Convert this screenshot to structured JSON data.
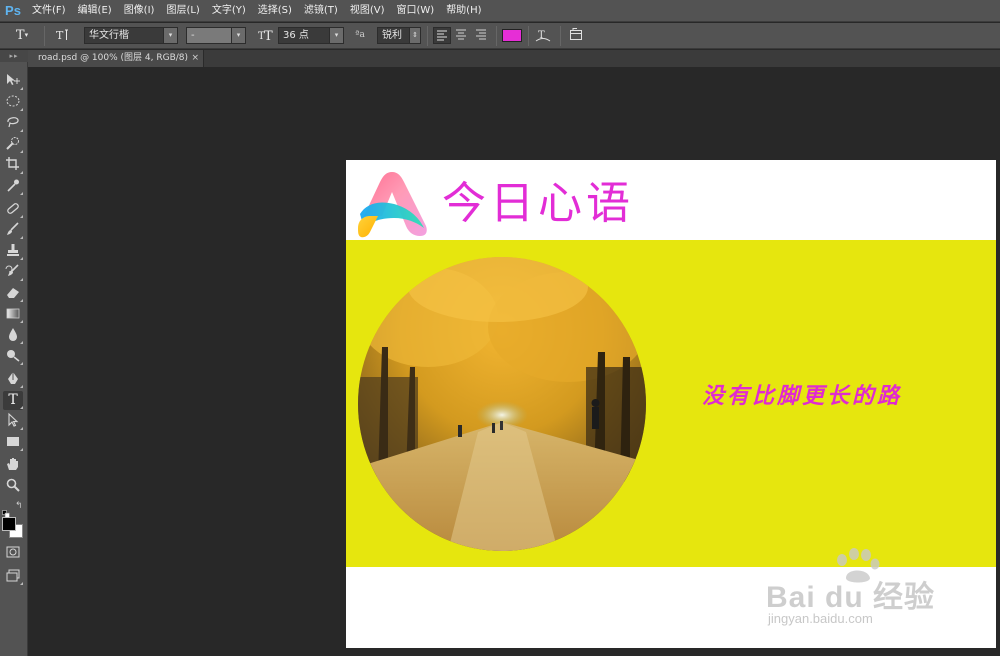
{
  "app": {
    "logo": "Ps"
  },
  "menu": [
    "文件(F)",
    "编辑(E)",
    "图像(I)",
    "图层(L)",
    "文字(Y)",
    "选择(S)",
    "滤镜(T)",
    "视图(V)",
    "窗口(W)",
    "帮助(H)"
  ],
  "options": {
    "tool_glyph": "T",
    "font_family": "华文行楷",
    "font_style": "-",
    "font_size": "36 点",
    "aa_label": "ªa",
    "antialias": "锐利",
    "text_color": "#e62ed6"
  },
  "document_tab": {
    "title": "road.psd @ 100% (图层 4, RGB/8)",
    "close": "×"
  },
  "canvas": {
    "headline": "今日心语",
    "slogan": "没有比脚更长的路",
    "headline_color": "#e22dd6",
    "band_color": "#e6e60e"
  },
  "watermark": {
    "word": "Bai  du 经验",
    "url": "jingyan.baidu.com"
  },
  "tools": [
    "move-tool",
    "marquee-tool",
    "lasso-tool",
    "quick-select-tool",
    "crop-tool",
    "eyedropper-tool",
    "healing-brush-tool",
    "brush-tool",
    "clone-stamp-tool",
    "history-brush-tool",
    "eraser-tool",
    "gradient-tool",
    "blur-tool",
    "dodge-tool",
    "pen-tool",
    "type-tool",
    "path-select-tool",
    "shape-tool",
    "hand-tool",
    "zoom-tool"
  ],
  "colors": {
    "foreground": "#000000",
    "background": "#ffffff"
  }
}
